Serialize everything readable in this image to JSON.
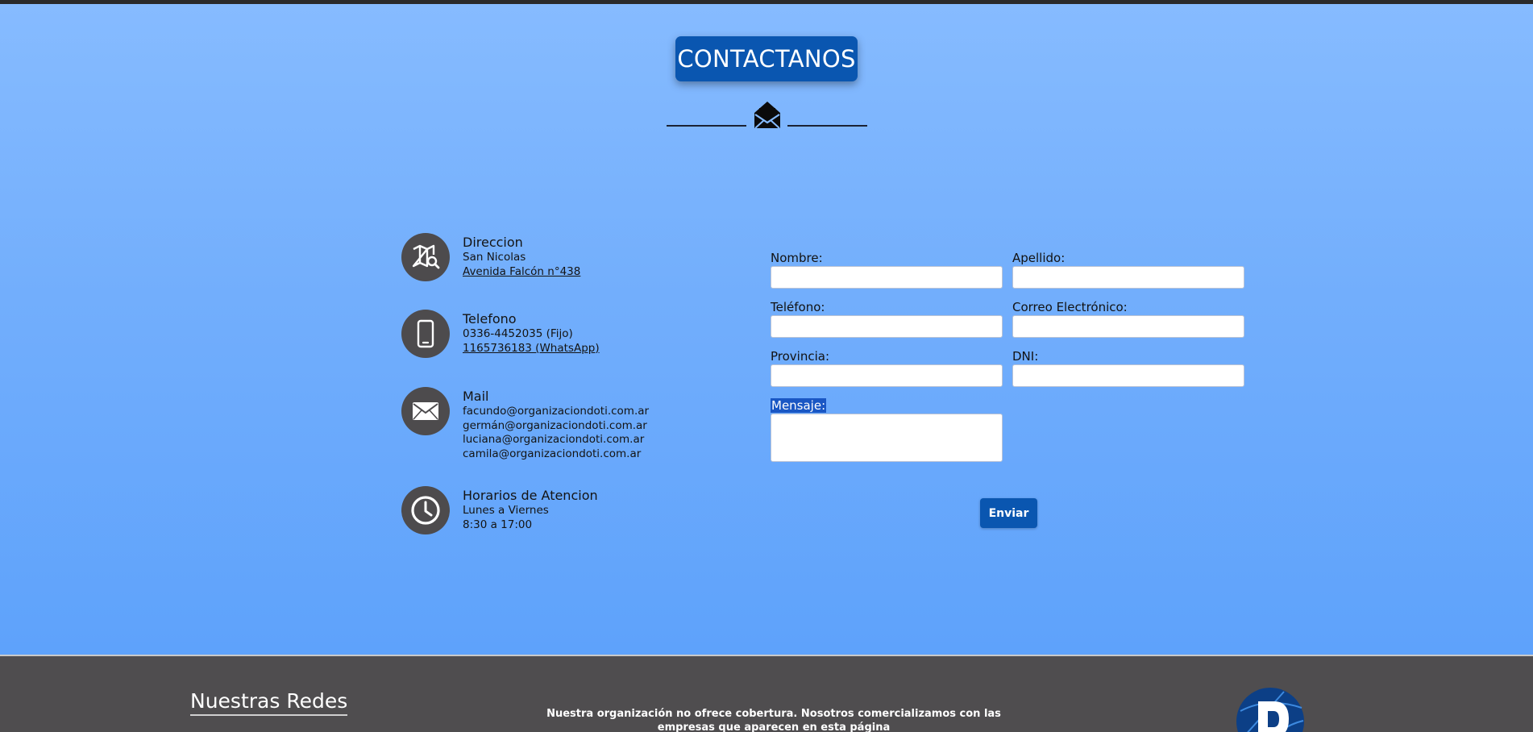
{
  "page": {
    "title": "CONTACTANOS"
  },
  "contact_info": [
    {
      "title": "Direccion",
      "icon": "map-search-icon",
      "lines": [
        {
          "text": "San Nicolas",
          "link": false
        },
        {
          "text": "Avenida Falcón n°438",
          "link": true
        }
      ]
    },
    {
      "title": "Telefono",
      "icon": "phone-icon",
      "lines": [
        {
          "text": "0336-4452035 (Fijo)",
          "link": false
        },
        {
          "text": "1165736183 (WhatsApp)",
          "link": true
        }
      ]
    },
    {
      "title": "Mail",
      "icon": "mail-icon",
      "lines": [
        {
          "text": "facundo@organizaciondoti.com.ar",
          "link": false
        },
        {
          "text": "germán@organizaciondoti.com.ar",
          "link": false
        },
        {
          "text": "luciana@organizaciondoti.com.ar",
          "link": false
        },
        {
          "text": "camila@organizaciondoti.com.ar",
          "link": false
        }
      ]
    },
    {
      "title": "Horarios de Atencion",
      "icon": "clock-icon",
      "lines": [
        {
          "text": "Lunes a Viernes",
          "link": false
        },
        {
          "text": "8:30 a 17:00",
          "link": false
        }
      ]
    }
  ],
  "form": {
    "nombre_label": "Nombre:",
    "apellido_label": "Apellido:",
    "telefono_label": "Teléfono:",
    "correo_label": "Correo Electrónico:",
    "provincia_label": "Provincia:",
    "dni_label": "DNI:",
    "mensaje_label": "Mensaje:",
    "nombre_value": "",
    "apellido_value": "",
    "telefono_value": "",
    "correo_value": "",
    "provincia_value": "",
    "dni_value": "",
    "mensaje_value": "",
    "submit_label": "Enviar"
  },
  "footer": {
    "redes_title": "Nuestras Redes",
    "disclaimer": "Nuestra organización no ofrece cobertura. Nosotros comercializamos con las empresas que aparecen en esta página"
  },
  "colors": {
    "accent": "#0a56b0",
    "background_top": "#86bbff",
    "background_bottom": "#5ea2fb",
    "footer": "#4f4d4f",
    "icon_circle": "#4d4b4d"
  }
}
